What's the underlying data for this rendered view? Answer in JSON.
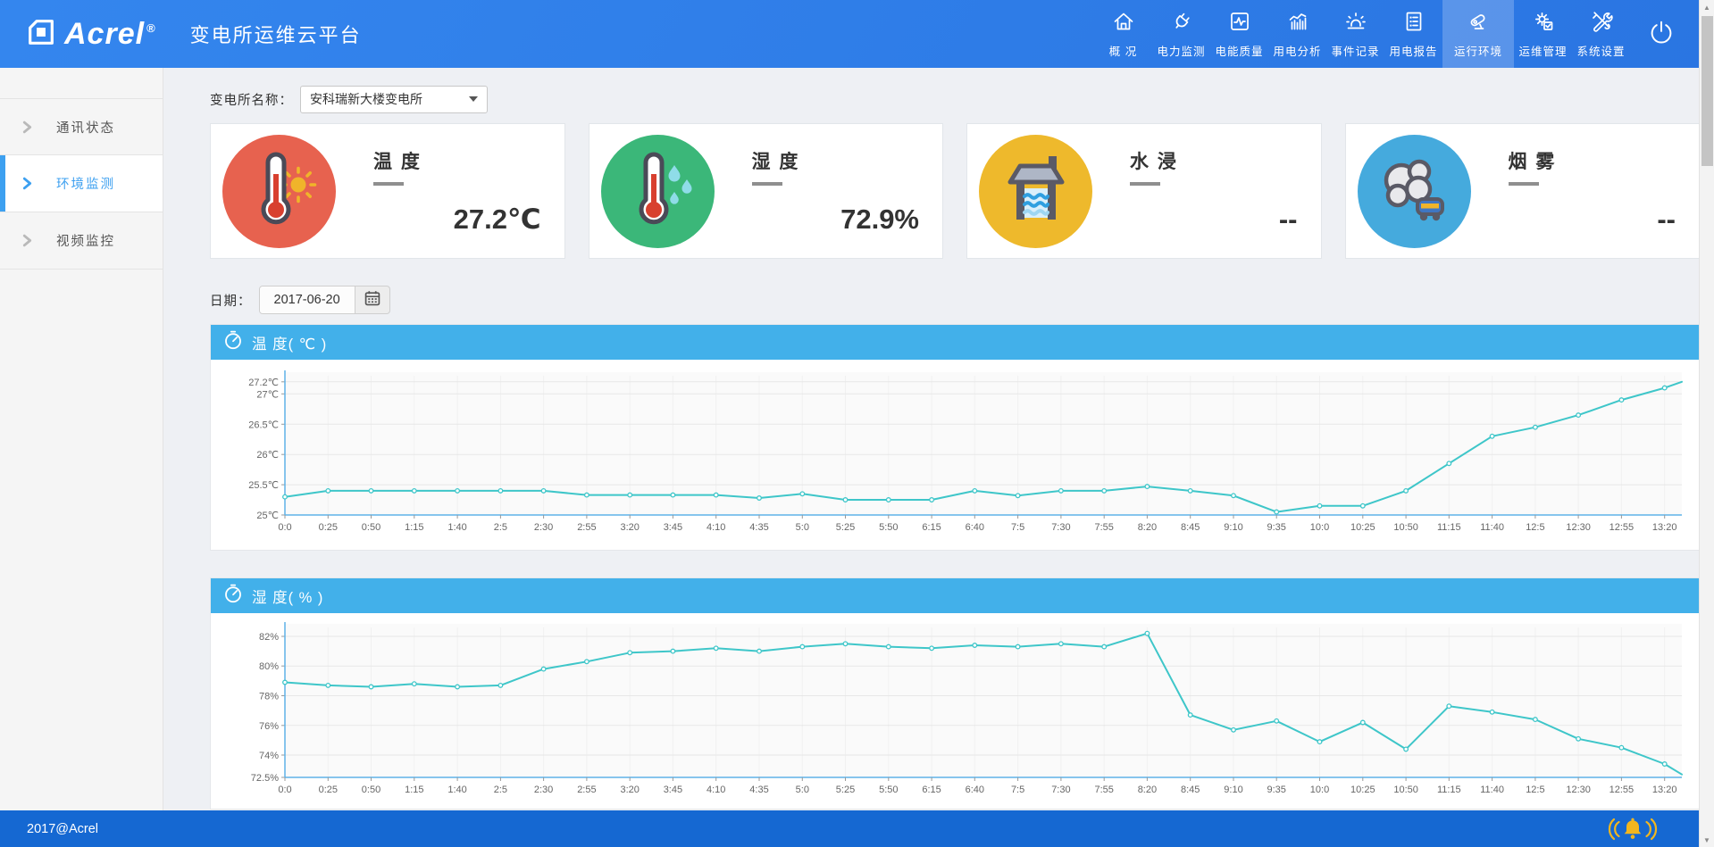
{
  "header": {
    "logo_text": "Acrel",
    "logo_reg": "®",
    "title": "变电所运维云平台",
    "nav_items": [
      {
        "label": "概 况",
        "icon": "home-icon",
        "active": false
      },
      {
        "label": "电力监测",
        "icon": "plug-icon",
        "active": false
      },
      {
        "label": "电能质量",
        "icon": "quality-icon",
        "active": false
      },
      {
        "label": "用电分析",
        "icon": "analysis-icon",
        "active": false
      },
      {
        "label": "事件记录",
        "icon": "event-icon",
        "active": false
      },
      {
        "label": "用电报告",
        "icon": "report-icon",
        "active": false
      },
      {
        "label": "运行环境",
        "icon": "camera-icon",
        "active": true
      },
      {
        "label": "运维管理",
        "icon": "ops-gear-icon",
        "active": false
      },
      {
        "label": "系统设置",
        "icon": "tools-icon",
        "active": false
      }
    ],
    "power_icon": "power-icon"
  },
  "sidebar": {
    "items": [
      {
        "label": "通讯状态",
        "active": false
      },
      {
        "label": "环境监测",
        "active": true
      },
      {
        "label": "视频监控",
        "active": false
      }
    ]
  },
  "toolbar": {
    "station_label": "变电所名称：",
    "station_value": "安科瑞新大楼变电所",
    "date_label": "日期：",
    "date_value": "2017-06-20"
  },
  "cards": [
    {
      "title": "温 度",
      "value": "27.2℃",
      "color": "#e7624f",
      "icon": "thermometer-sun-icon"
    },
    {
      "title": "湿 度",
      "value": "72.9%",
      "color": "#3bb779",
      "icon": "thermometer-drops-icon"
    },
    {
      "title": "水 浸",
      "value": "--",
      "color": "#eeb92c",
      "icon": "water-well-icon"
    },
    {
      "title": "烟 雾",
      "value": "--",
      "color": "#45aadd",
      "icon": "smoke-icon"
    }
  ],
  "footer": {
    "copyright": "2017@Acrel",
    "bell_icon": "alarm-bell-icon"
  },
  "colors": {
    "header_blue": "#2b7ce6",
    "panel_header_blue": "#42b0ea",
    "footer_blue": "#1568d2",
    "line_teal": "#3ec6c9",
    "sidebar_active_blue": "#3da0f0"
  },
  "chart_data": [
    {
      "type": "line",
      "title": "温 度( ℃ )",
      "series_name": "温度",
      "series_color": "#3ec6c9",
      "legend_position": "none",
      "grid": true,
      "x": [
        "0:0",
        "0:25",
        "0:50",
        "1:15",
        "1:40",
        "2:5",
        "2:30",
        "2:55",
        "3:20",
        "3:45",
        "4:10",
        "4:35",
        "5:0",
        "5:25",
        "5:50",
        "6:15",
        "6:40",
        "7:5",
        "7:30",
        "7:55",
        "8:20",
        "8:45",
        "9:10",
        "9:35",
        "10:0",
        "10:25",
        "10:50",
        "11:15",
        "11:40",
        "12:5",
        "12:30",
        "12:55",
        "13:20"
      ],
      "values": [
        25.3,
        25.4,
        25.4,
        25.4,
        25.4,
        25.4,
        25.4,
        25.33,
        25.33,
        25.33,
        25.33,
        25.28,
        25.35,
        25.25,
        25.25,
        25.25,
        25.4,
        25.32,
        25.4,
        25.4,
        25.47,
        25.4,
        25.32,
        25.05,
        25.15,
        25.15,
        25.4,
        25.85,
        26.3,
        26.45,
        26.65,
        26.9,
        27.1
      ],
      "end_value": 27.2,
      "y_tick_labels": [
        "27.2℃",
        "27℃",
        "26.5℃",
        "26℃",
        "25.5℃",
        "25℃"
      ],
      "y_tick_values": [
        27.2,
        27,
        26.5,
        26,
        25.5,
        25
      ],
      "ylim": [
        25,
        27.3
      ]
    },
    {
      "type": "line",
      "title": "湿 度( % )",
      "series_name": "湿度",
      "series_color": "#3ec6c9",
      "legend_position": "none",
      "grid": true,
      "x": [
        "0:0",
        "0:25",
        "0:50",
        "1:15",
        "1:40",
        "2:5",
        "2:30",
        "2:55",
        "3:20",
        "3:45",
        "4:10",
        "4:35",
        "5:0",
        "5:25",
        "5:50",
        "6:15",
        "6:40",
        "7:5",
        "7:30",
        "7:55",
        "8:20",
        "8:45",
        "9:10",
        "9:35",
        "10:0",
        "10:25",
        "10:50",
        "11:15",
        "11:40",
        "12:5",
        "12:30",
        "12:55",
        "13:20"
      ],
      "values": [
        78.9,
        78.7,
        78.6,
        78.8,
        78.6,
        78.7,
        79.8,
        80.3,
        80.9,
        81.0,
        81.2,
        81.0,
        81.3,
        81.5,
        81.3,
        81.2,
        81.4,
        81.3,
        81.5,
        81.3,
        82.2,
        76.7,
        75.7,
        76.3,
        74.9,
        76.2,
        74.4,
        77.3,
        76.9,
        76.4,
        75.1,
        74.5,
        73.4
      ],
      "end_value": 72.7,
      "y_tick_labels": [
        "82%",
        "80%",
        "78%",
        "76%",
        "74%",
        "72.5%"
      ],
      "y_tick_values": [
        82,
        80,
        78,
        76,
        74,
        72.5
      ],
      "ylim": [
        72.5,
        82.6
      ]
    }
  ]
}
